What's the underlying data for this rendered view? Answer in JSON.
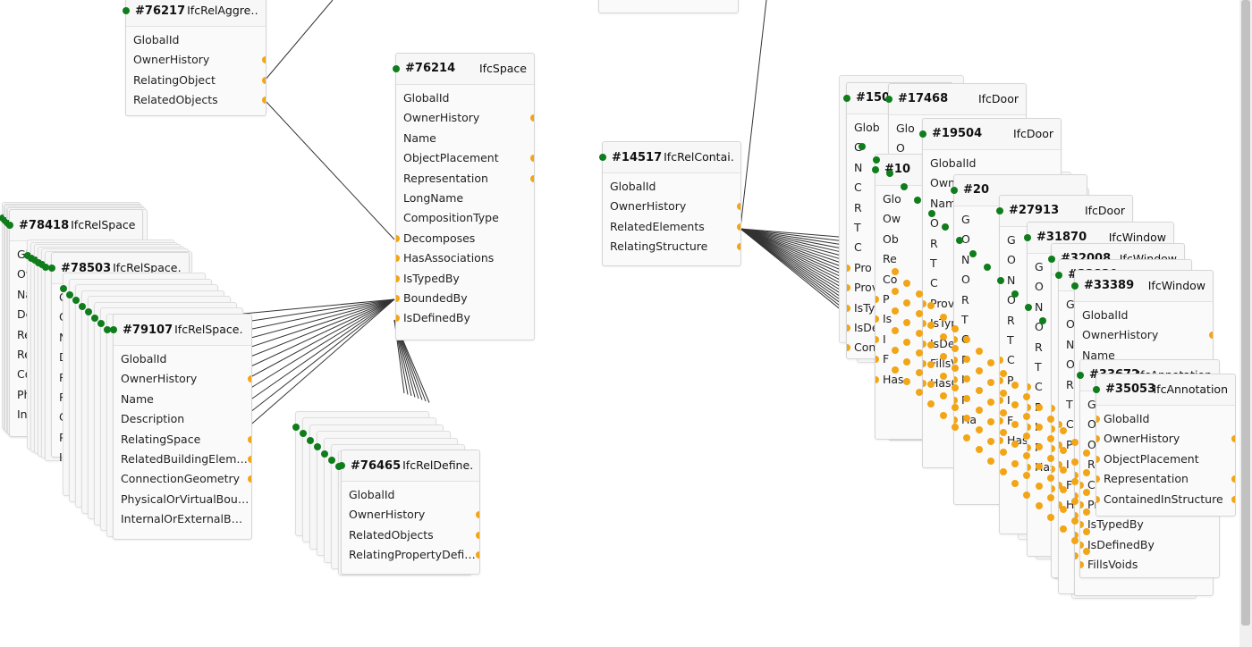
{
  "colors": {
    "accent_green": "#0f7d1c",
    "port_orange": "#f2a516",
    "wire": "#333333"
  },
  "nodes": [
    {
      "id": "#76217",
      "cls": "IfcRelAggre…",
      "type": "",
      "rows": [
        "GlobalId",
        "OwnerHistory",
        "RelatingObject",
        "RelatedObjects"
      ],
      "ports": [
        false,
        true,
        true,
        true
      ]
    },
    {
      "id": "#76214",
      "cls": "",
      "type": "IfcSpace",
      "rows": [
        "GlobalId",
        "OwnerHistory",
        "Name",
        "ObjectPlacement",
        "Representation",
        "LongName",
        "CompositionType",
        "Decomposes",
        "HasAssociations",
        "IsTypedBy",
        "BoundedBy",
        "IsDefinedBy"
      ]
    },
    {
      "id": "#78418",
      "cls": "IfcRelSpace…",
      "type": "",
      "rows": [
        "Glo",
        "Ow",
        "Na",
        "De",
        "Re",
        "Re",
        "Co",
        "Phy",
        "Inte"
      ]
    },
    {
      "id": "#78503",
      "cls": "IfcRelSpace…",
      "type": "",
      "rows": [
        "G",
        "O",
        "N",
        "D",
        "R",
        "R",
        "C",
        "P",
        "I"
      ]
    },
    {
      "id": "#79107",
      "cls": "IfcRelSpace…",
      "type": "",
      "rows": [
        "GlobalId",
        "OwnerHistory",
        "Name",
        "Description",
        "RelatingSpace",
        "RelatedBuildingElem…",
        "ConnectionGeometry",
        "PhysicalOrVirtualBou…",
        "InternalOrExternalB…"
      ]
    },
    {
      "id": "#76465",
      "cls": "IfcRelDefine…",
      "type": "",
      "rows": [
        "GlobalId",
        "OwnerHistory",
        "RelatedObjects",
        "RelatingPropertyDefi…"
      ]
    },
    {
      "id": "#14517",
      "cls": "IfcRelContai…",
      "type": "",
      "rows": [
        "GlobalId",
        "OwnerHistory",
        "RelatedElements",
        "RelatingStructure"
      ]
    },
    {
      "id": "#150",
      "cls": "",
      "type": "",
      "rows": [
        "Glob",
        "G",
        "N",
        "C",
        "R",
        "T",
        "C",
        "Pro",
        "Prov",
        "IsTyp",
        "IsDef",
        "Conn"
      ]
    },
    {
      "id": "#17468",
      "cls": "",
      "type": "IfcDoor",
      "rows": [
        "Glo",
        "O",
        "N",
        "O",
        "R",
        "T",
        "C",
        "P",
        "I",
        "F",
        "Ha"
      ]
    },
    {
      "id": "#10",
      "cls": "",
      "type": "",
      "rows": [
        "Glo",
        "Ow",
        "Ob",
        "Re",
        "Co",
        "P",
        "Is",
        "I",
        "F",
        "Has"
      ]
    },
    {
      "id": "#19504",
      "cls": "",
      "type": "IfcDoor",
      "rows": [
        "GlobalId",
        "Own",
        "Nam",
        "O",
        "R",
        "T",
        "C",
        "Prov",
        "IsTyp",
        "IsDel",
        "FillsV",
        "HasOpen"
      ]
    },
    {
      "id": "#20",
      "cls": "",
      "type": "",
      "rows": [
        "G",
        "O",
        "N",
        "O",
        "R",
        "T",
        "C",
        "P",
        "I",
        "F",
        "Ha"
      ]
    },
    {
      "id": "#27913",
      "cls": "",
      "type": "IfcDoor",
      "rows": [
        "G",
        "O",
        "N",
        "O",
        "R",
        "T",
        "C",
        "P",
        "I",
        "F",
        "Has"
      ]
    },
    {
      "id": "#31870",
      "cls": "",
      "type": "IfcWindow",
      "rows": [
        "G",
        "O",
        "N",
        "O",
        "R",
        "T",
        "C",
        "P",
        "I",
        "F",
        "Has"
      ]
    },
    {
      "id": "#32008",
      "cls": "",
      "type": "IfcWindow",
      "rows": [
        "G",
        "O",
        "N",
        "O",
        "R",
        "T",
        "C",
        "P",
        "I",
        "F",
        "Ha"
      ]
    },
    {
      "id": "#32829",
      "cls": "",
      "type": "IfcWindow",
      "rows": [
        "G",
        "O",
        "N",
        "O",
        "R",
        "T",
        "C",
        "P",
        "I",
        "F",
        "Ha"
      ]
    },
    {
      "id": "#33389",
      "cls": "",
      "type": "IfcWindow",
      "rows": [
        "GlobalId",
        "OwnerHistory",
        "Name",
        "O",
        "R",
        "T",
        "C",
        "H",
        "Prov",
        "IsT",
        "IsD",
        "Fi",
        "Ha"
      ]
    },
    {
      "id": "#33672",
      "cls": "",
      "type": "IfcAnnotation",
      "rows": [
        "GlobalId",
        "OwnerHistory",
        "ObjectPlacement",
        "Representation",
        "ContainedInStructure",
        "ProvidesBoundaries",
        "IsTypedBy",
        "IsDefinedBy",
        "FillsVoids"
      ]
    },
    {
      "id": "#35053",
      "cls": "",
      "type": "IfcAnnotation",
      "rows": [
        "GlobalId",
        "OwnerHistory",
        "ObjectPlacement",
        "Representation",
        "ContainedInStructure"
      ]
    }
  ]
}
